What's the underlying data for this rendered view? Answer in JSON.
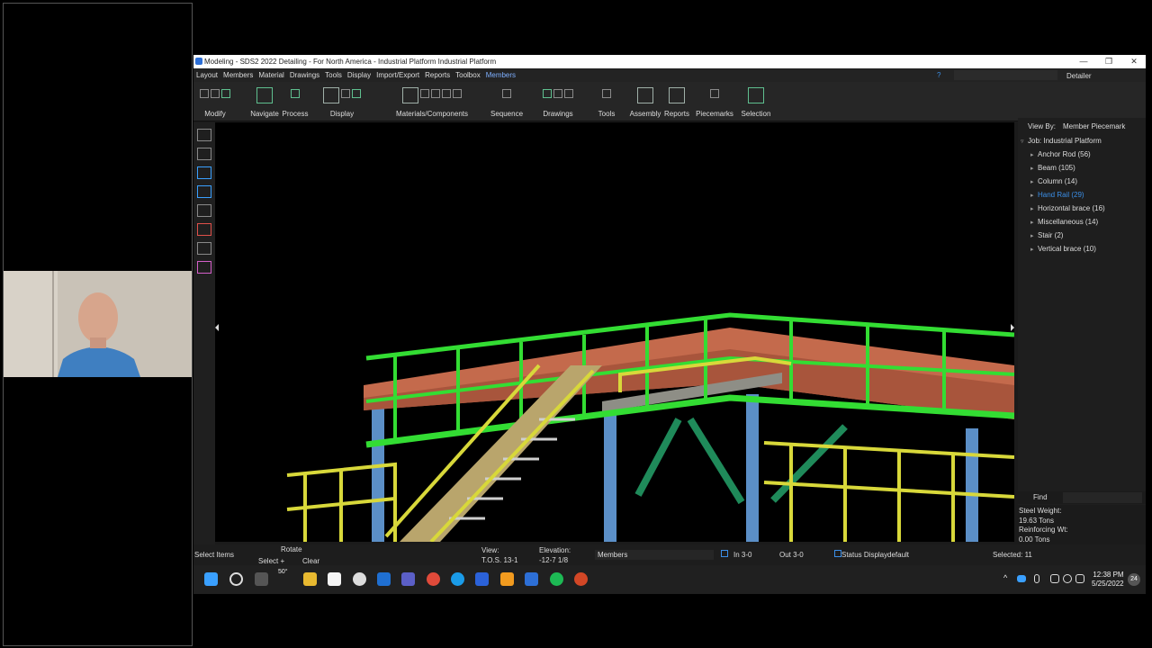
{
  "window": {
    "title": "Modeling - SDS2 2022 Detailing - For North America - Industrial Platform Industrial Platform",
    "controls": [
      "—",
      "❒",
      "✕"
    ]
  },
  "menu": {
    "items": [
      "Layout",
      "Members",
      "Material",
      "Drawings",
      "Tools",
      "Display",
      "Import/Export",
      "Reports",
      "Toolbox",
      "Members"
    ],
    "active_index": 9,
    "role": "Detailer"
  },
  "ribbon": {
    "groups": [
      "Modify",
      "Navigate",
      "Process",
      "Display",
      "Materials/Components",
      "Sequence",
      "Drawings",
      "Tools",
      "Assembly",
      "Reports",
      "Piecemarks",
      "Selection"
    ]
  },
  "panel": {
    "view_by_label": "View By:",
    "view_by_value": "Member Piecemark",
    "root": "Job: Industrial Platform",
    "items": [
      "Anchor Rod (56)",
      "Beam (105)",
      "Column (14)",
      "Hand Rail (29)",
      "Horizontal brace (16)",
      "Miscellaneous (14)",
      "Stair (2)",
      "Vertical brace (10)"
    ],
    "selected_index": 3,
    "find_label": "Find",
    "steel_weight_label": "Steel Weight:",
    "steel_weight_value": "19.63 Tons",
    "reinforcing_label": "Reinforcing Wt:",
    "reinforcing_value": "0.00 Tons"
  },
  "status": {
    "select_items": "Select Items",
    "rotate": "Rotate",
    "select_plus": "Select +",
    "clear": "Clear",
    "view_label": "View:",
    "view_value": "T.O.S. 13-1",
    "elevation_label": "Elevation:",
    "elevation_value": "-12-7 1/8",
    "filter": "Members",
    "in_value": "In 3-0",
    "out_value": "Out 3-0",
    "status_display": "Status Display",
    "status_display_value": "default",
    "selected": "Selected: 11"
  },
  "taskbar": {
    "weather": "50°",
    "time": "12:38 PM",
    "date": "5/25/2022",
    "badge": "24"
  },
  "colors": {
    "handrail_green": "#33dd33",
    "handrail_yellow": "#d8d83a",
    "beam_salmon": "#c46a4c",
    "column_blue": "#5b8fc7",
    "brace_teal": "#1f8a5a",
    "stair_tan": "#b9a56c",
    "accent": "#3b8fe8"
  }
}
